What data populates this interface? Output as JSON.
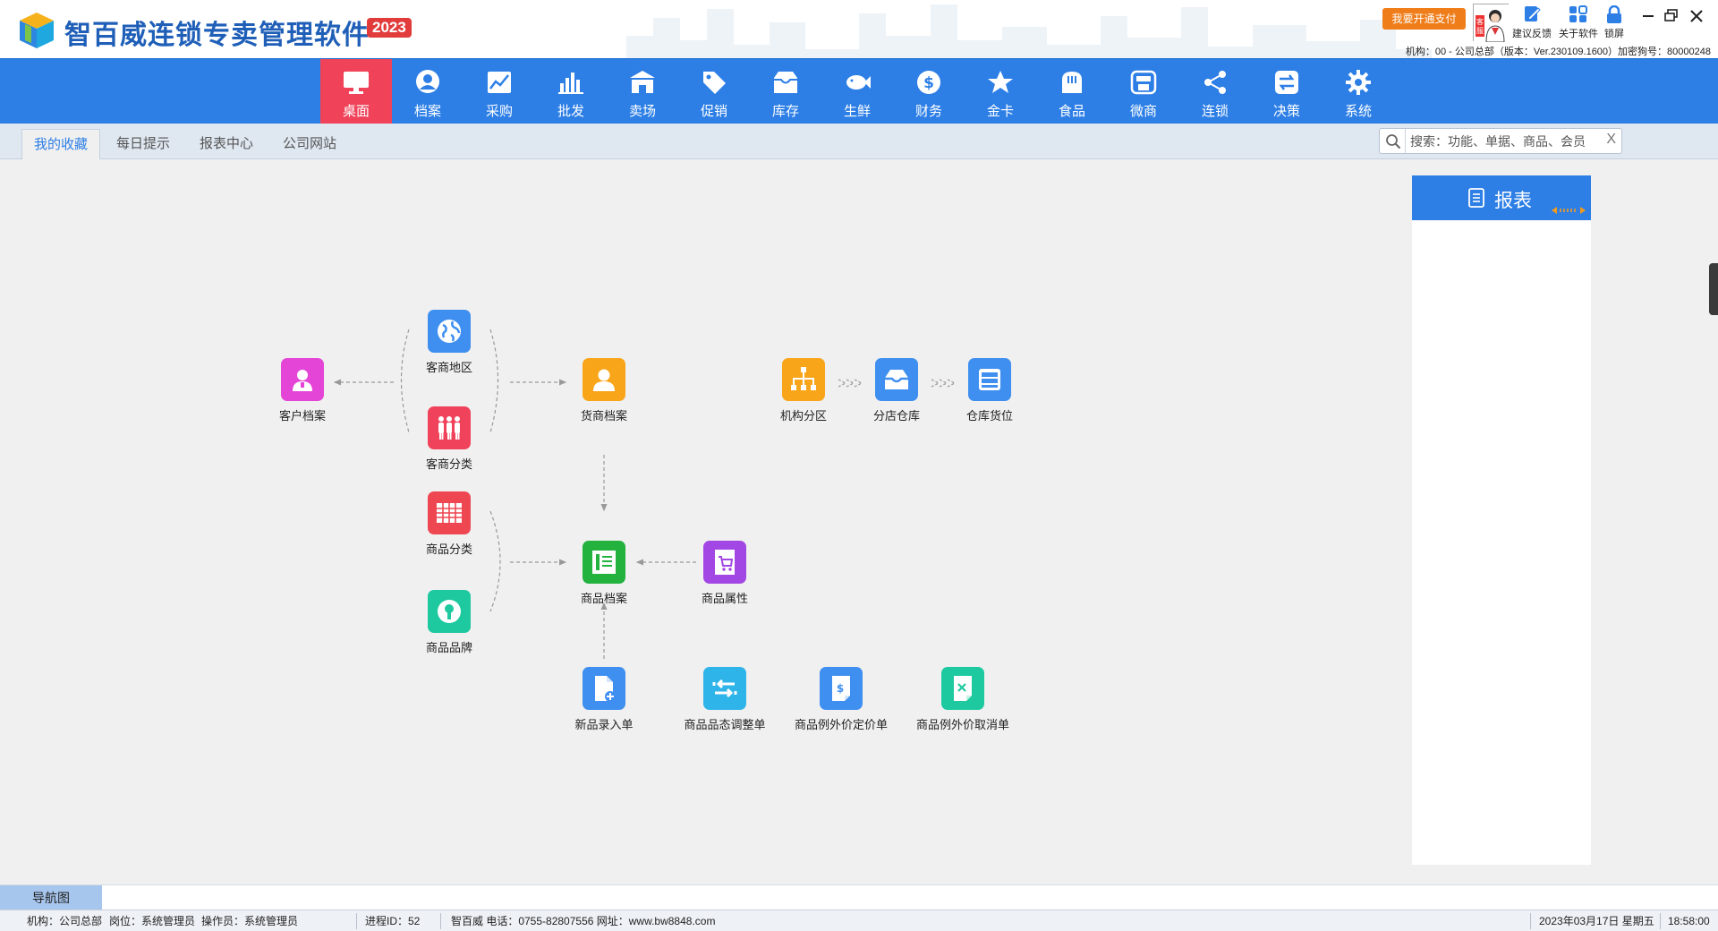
{
  "app": {
    "title": "智百威连锁专卖管理软件",
    "year": "2023",
    "pay_button": "我要开通支付",
    "cs_label": "客服",
    "tools": [
      {
        "label": "建议反馈",
        "icon": "feedback-icon"
      },
      {
        "label": "关于软件",
        "icon": "about-icon"
      },
      {
        "label": "锁屏",
        "icon": "lock-icon"
      }
    ],
    "org_info": "机构：00 - 公司总部（版本：Ver.230109.1600）加密狗号：80000248"
  },
  "menu": {
    "items": [
      {
        "label": "桌面",
        "icon": "monitor-icon"
      },
      {
        "label": "档案",
        "icon": "user-file-icon"
      },
      {
        "label": "采购",
        "icon": "purchase-chart-icon"
      },
      {
        "label": "批发",
        "icon": "bar-chart-icon"
      },
      {
        "label": "卖场",
        "icon": "store-icon"
      },
      {
        "label": "促销",
        "icon": "tag-icon"
      },
      {
        "label": "库存",
        "icon": "inbox-icon"
      },
      {
        "label": "生鲜",
        "icon": "fish-icon"
      },
      {
        "label": "财务",
        "icon": "dollar-icon"
      },
      {
        "label": "金卡",
        "icon": "star-icon"
      },
      {
        "label": "食品",
        "icon": "bread-icon"
      },
      {
        "label": "微商",
        "icon": "shop-icon"
      },
      {
        "label": "连锁",
        "icon": "share-icon"
      },
      {
        "label": "决策",
        "icon": "exchange-icon"
      },
      {
        "label": "系统",
        "icon": "gear-icon"
      }
    ],
    "active_index": 0
  },
  "tabs": {
    "items": [
      "我的收藏",
      "每日提示",
      "报表中心",
      "公司网站"
    ],
    "active_index": 0
  },
  "search": {
    "placeholder": "搜索：功能、单据、商品、会员",
    "clear": "X"
  },
  "diagram": {
    "nodes": [
      {
        "id": "customer",
        "label": "客户档案",
        "color": "#e545d6",
        "icon": "customer-icon"
      },
      {
        "id": "region",
        "label": "客商地区",
        "color": "#3f8ff0",
        "icon": "globe-icon"
      },
      {
        "id": "category",
        "label": "客商分类",
        "color": "#f0425a",
        "icon": "people-icon"
      },
      {
        "id": "supplier",
        "label": "货商档案",
        "color": "#f8a51a",
        "icon": "supplier-icon"
      },
      {
        "id": "branch_zone",
        "label": "机构分区",
        "color": "#f8a51a",
        "icon": "org-tree-icon"
      },
      {
        "id": "branch_store",
        "label": "分店仓库",
        "color": "#3f8ff0",
        "icon": "warehouse-icon"
      },
      {
        "id": "store_pos",
        "label": "仓库货位",
        "color": "#3f8ff0",
        "icon": "cabinet-icon"
      },
      {
        "id": "goods_cat",
        "label": "商品分类",
        "color": "#ee4752",
        "icon": "table-icon"
      },
      {
        "id": "goods_brand",
        "label": "商品品牌",
        "color": "#1ec9a0",
        "icon": "brand-icon"
      },
      {
        "id": "goods",
        "label": "商品档案",
        "color": "#22b23d",
        "icon": "goods-file-icon"
      },
      {
        "id": "goods_attr",
        "label": "商品属性",
        "color": "#a347e4",
        "icon": "cart-icon"
      },
      {
        "id": "new_goods",
        "label": "新品录入单",
        "color": "#3f8ff0",
        "icon": "new-doc-icon"
      },
      {
        "id": "status_adj",
        "label": "商品品态调整单",
        "color": "#2fb4ea",
        "icon": "adjust-icon"
      },
      {
        "id": "price_set",
        "label": "商品例外价定价单",
        "color": "#3f8ff0",
        "icon": "price-doc-icon"
      },
      {
        "id": "price_cancel",
        "label": "商品例外价取消单",
        "color": "#1ec9a0",
        "icon": "cancel-doc-icon"
      }
    ]
  },
  "report": {
    "title": "报表"
  },
  "bottom": {
    "nav_tab": "导航图"
  },
  "status": {
    "org": "机构：公司总部",
    "post": "岗位：系统管理员",
    "operator": "操作员：系统管理员",
    "process": "进程ID：52",
    "contact": "智百威 电话：0755-82807556 网址：www.bw8848.com",
    "date": "2023年03月17日 星期五",
    "time": "18:58:00"
  }
}
